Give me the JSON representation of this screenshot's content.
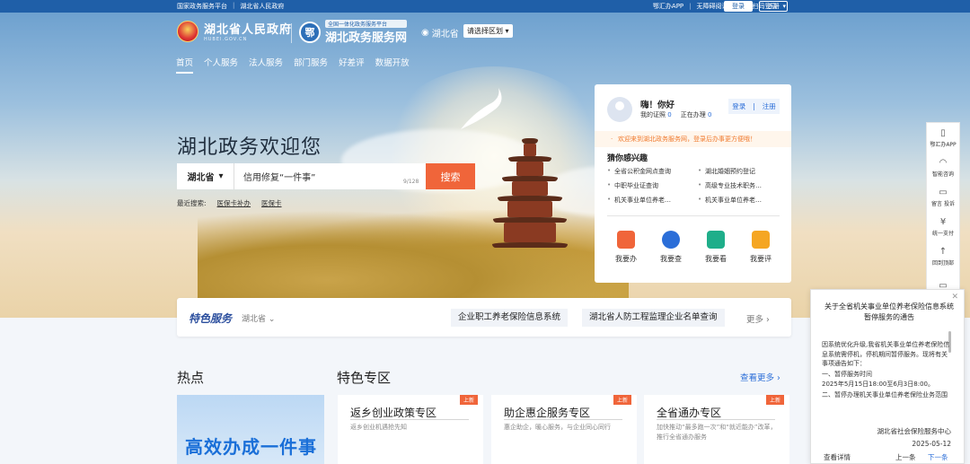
{
  "topbar": {
    "links": [
      "国家政务服务平台",
      "湖北省人民政府"
    ],
    "right_links": [
      "鄂汇办APP",
      "无障碍阅读",
      "扫码登录"
    ],
    "login": "登录",
    "register": "注册"
  },
  "brand": {
    "name": "湖北省人民政府",
    "domain": "HUBEI.GOV.CN",
    "platform_tag": "全国一体化政务服务平台",
    "platform_name": "湖北政务服务网",
    "region": "湖北省",
    "region_select": "请选择区划"
  },
  "nav": [
    "首页",
    "个人服务",
    "法人服务",
    "部门服务",
    "好差评",
    "数据开放"
  ],
  "hero": {
    "welcome": "湖北政务欢迎您",
    "search_region": "湖北省",
    "search_value": "信用修复“一件事”",
    "counter": "9/128",
    "search_button": "搜索",
    "recent_label": "最近搜索:",
    "recent": [
      "医保卡补办",
      "医保卡"
    ]
  },
  "user_card": {
    "greeting": "嗨！你好",
    "cert_label": "我的证照",
    "cert_count": "0",
    "doing_label": "正在办理",
    "doing_count": "0",
    "login": "登录",
    "register": "注册",
    "notice": "欢迎来到湖北政务服务网，登录后办事更方便哦！",
    "guess_title": "猜你感兴趣",
    "guess": [
      "全省公积金网点查询",
      "湖北婚姻预约登记",
      "中职毕业证查询",
      "高级专业技术职务…",
      "机关事业单位养老…",
      "机关事业单位养老…"
    ],
    "actions": [
      {
        "label": "我要办",
        "color": "#f0653a"
      },
      {
        "label": "我要查",
        "color": "#2b6ed8"
      },
      {
        "label": "我要看",
        "color": "#1fae8a"
      },
      {
        "label": "我要评",
        "color": "#f5a623"
      }
    ]
  },
  "side": [
    "鄂汇办APP",
    "智能咨询",
    "留言 投诉",
    "统一支付",
    "回到顶部"
  ],
  "features": {
    "title": "特色服务",
    "region": "湖北省",
    "items": [
      "企业职工养老保险信息系统",
      "湖北省人防工程监理企业名单查询"
    ],
    "more": "更多"
  },
  "hot": {
    "title": "热点",
    "banner": "高效办成一件事"
  },
  "zones": {
    "title": "特色专区",
    "more": "查看更多",
    "items": [
      {
        "tag": "上新",
        "title": "返乡创业政策专区",
        "desc": "返乡创业机遇抢先知"
      },
      {
        "tag": "上新",
        "title": "助企惠企服务专区",
        "desc": "惠企助企，暖心服务，与企业同心同行"
      },
      {
        "tag": "上新",
        "title": "全省通办专区",
        "desc": "加快推动“最多跑一次”和“就近能办”改革，推行全省通办服务"
      }
    ]
  },
  "popup": {
    "title": "关于全省机关事业单位养老保险信息系统暂停服务的通告",
    "body": [
      "因系统优化升级,我省机关事业单位养老保险信息系统需停机，停机期间暂停服务。现将有关事项通告如下：",
      "一、暂停服务时间",
      "2025年5月15日18:00至6月3日8:00。",
      "二、暂停办理机关事业单位养老保险业务范围"
    ],
    "org": "湖北省社会保险服务中心",
    "date": "2025-05-12",
    "detail": "查看详情",
    "prev": "上一条",
    "next": "下一条"
  }
}
